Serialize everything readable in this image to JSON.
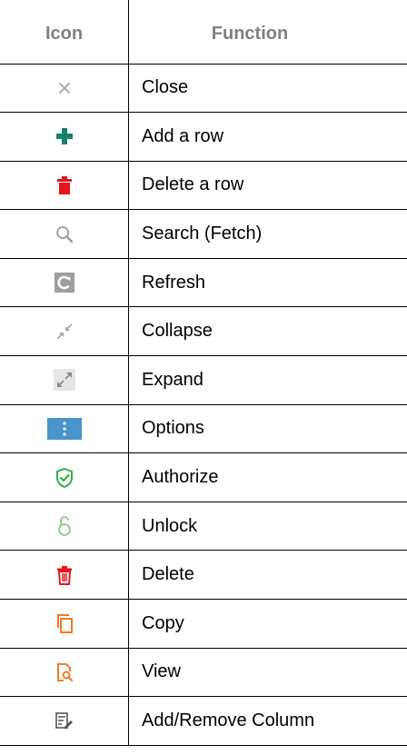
{
  "header": {
    "icon_col": "Icon",
    "function_col": "Function"
  },
  "rows": [
    {
      "icon": "close-icon",
      "label": "Close"
    },
    {
      "icon": "add-row-icon",
      "label": "Add a row"
    },
    {
      "icon": "delete-row-icon",
      "label": "Delete a row"
    },
    {
      "icon": "search-icon",
      "label": "Search (Fetch)"
    },
    {
      "icon": "refresh-icon",
      "label": "Refresh"
    },
    {
      "icon": "collapse-icon",
      "label": "Collapse"
    },
    {
      "icon": "expand-icon",
      "label": "Expand"
    },
    {
      "icon": "options-icon",
      "label": "Options"
    },
    {
      "icon": "authorize-icon",
      "label": "Authorize"
    },
    {
      "icon": "unlock-icon",
      "label": "Unlock"
    },
    {
      "icon": "delete-icon",
      "label": "Delete"
    },
    {
      "icon": "copy-icon",
      "label": "Copy"
    },
    {
      "icon": "view-icon",
      "label": "View"
    },
    {
      "icon": "add-remove-column-icon",
      "label": "Add/Remove Column"
    }
  ],
  "colors": {
    "close": "#b0b0b0",
    "add": "#17806f",
    "delete_row": "#e8141c",
    "search": "#9a9a9a",
    "refresh_bg": "#9e9e9e",
    "collapse": "#a6a6a6",
    "expand_bg": "#e6e6e6",
    "expand": "#8a8a8a",
    "options_bg": "#4a95cc",
    "authorize": "#2db34a",
    "unlock": "#7cc47a",
    "delete": "#e8141c",
    "copy": "#f27b22",
    "view": "#f27b22",
    "column": "#555555"
  }
}
